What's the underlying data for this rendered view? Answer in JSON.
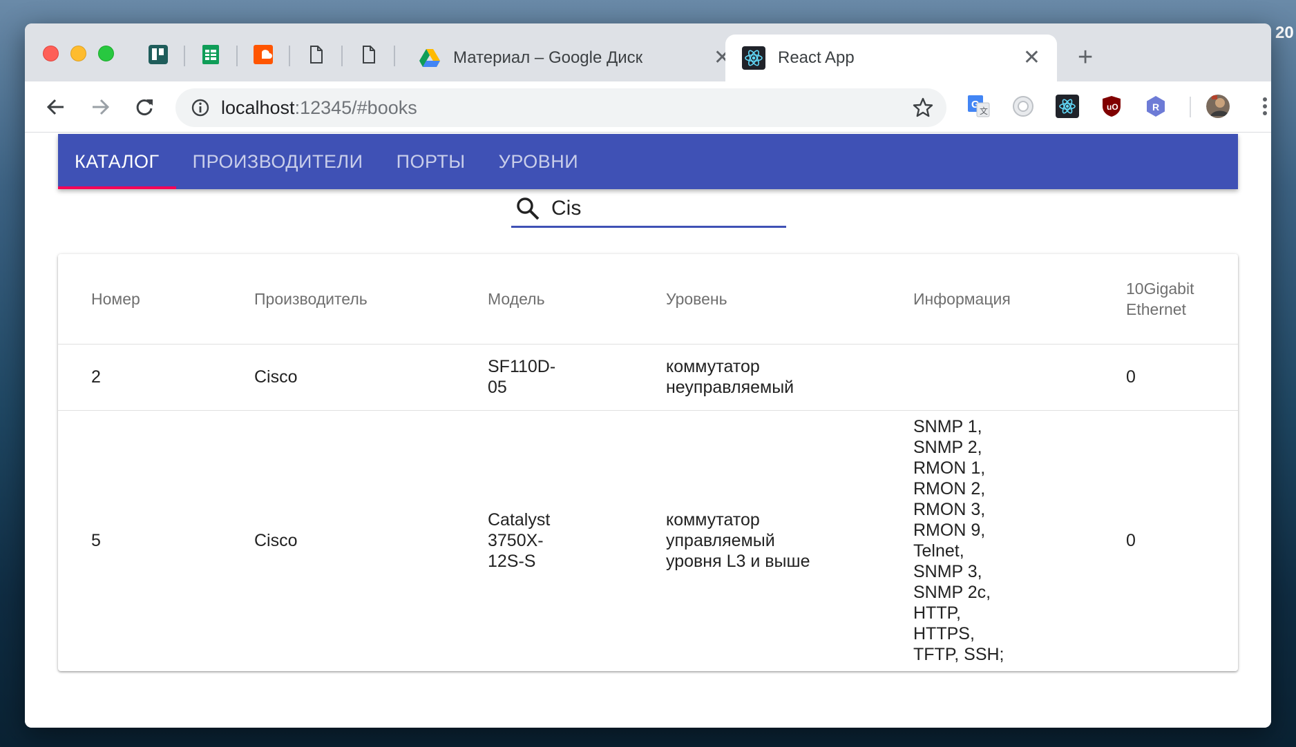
{
  "desktop": {
    "clock_fragment": "20"
  },
  "browser": {
    "tabs": [
      {
        "title": "Материал – Google Диск",
        "close": "✕"
      },
      {
        "title": "React App",
        "close": "✕"
      }
    ],
    "new_tab": "+",
    "url_host": "localhost",
    "url_rest": ":12345/#books"
  },
  "app": {
    "nav_tabs": [
      "КАТАЛОГ",
      "ПРОИЗВОДИТЕЛИ",
      "ПОРТЫ",
      "УРОВНИ"
    ],
    "selected_tab": 0,
    "search": {
      "value": "Cis"
    },
    "table": {
      "headers": [
        "Номер",
        "Производитель",
        "Модель",
        "Уровень",
        "Информация",
        "10Gigabit Ethernet"
      ],
      "rows": [
        {
          "number": "2",
          "manufacturer": "Cisco",
          "model": "SF110D-05",
          "level": "коммутатор неуправляемый",
          "info": "",
          "ten_gig": "0"
        },
        {
          "number": "5",
          "manufacturer": "Cisco",
          "model": "Catalyst 3750X-12S-S",
          "level": "коммутатор управляемый уровня L3 и выше",
          "info": "SNMP 1, SNMP 2, RMON 1, RMON 2, RMON 3, RMON 9, Telnet, SNMP 3, SNMP 2c, HTTP, HTTPS, TFTP, SSH;",
          "ten_gig": "0"
        }
      ]
    }
  },
  "colors": {
    "appbar": "#3f51b5",
    "indicator": "#f50057",
    "tabstrip": "#dee1e6"
  }
}
